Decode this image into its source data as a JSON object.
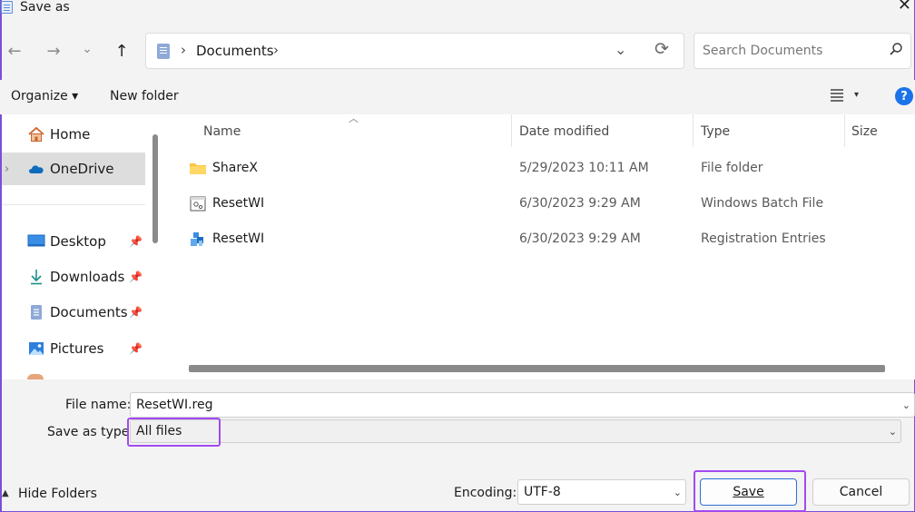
{
  "window": {
    "title": "Save as",
    "close_glyph": "✕"
  },
  "nav": {
    "back": "←",
    "forward": "→",
    "recent": "⌄",
    "up": "↑"
  },
  "address": {
    "separator": "›",
    "folder": "Documents",
    "dropdown": "⌄",
    "refresh": "⟳"
  },
  "search": {
    "placeholder": "Search Documents",
    "icon": "search-icon"
  },
  "toolbar": {
    "organize": "Organize ▾",
    "new_folder": "New folder",
    "help": "?"
  },
  "sidebar": {
    "items": [
      {
        "label": "Home",
        "icon": "home-icon"
      },
      {
        "label": "OneDrive",
        "icon": "cloud-icon",
        "selected": true
      },
      {
        "label": "Desktop",
        "icon": "desktop-icon",
        "pinned": true
      },
      {
        "label": "Downloads",
        "icon": "download-icon",
        "pinned": true
      },
      {
        "label": "Documents",
        "icon": "document-icon",
        "pinned": true
      },
      {
        "label": "Pictures",
        "icon": "picture-icon",
        "pinned": true
      }
    ]
  },
  "columns": [
    "Name",
    "Date modified",
    "Type",
    "Size"
  ],
  "files": [
    {
      "name": "ShareX",
      "date": "5/29/2023 10:11 AM",
      "type": "File folder",
      "icon": "folder-icon"
    },
    {
      "name": "ResetWI",
      "date": "6/30/2023 9:29 AM",
      "type": "Windows Batch File",
      "icon": "batch-file-icon"
    },
    {
      "name": "ResetWI",
      "date": "6/30/2023 9:29 AM",
      "type": "Registration Entries",
      "icon": "registry-file-icon"
    }
  ],
  "form": {
    "file_name_label": "File name:",
    "file_name_value": "ResetWI.reg",
    "save_type_label": "Save as type:",
    "save_type_value": "All files",
    "encoding_label": "Encoding:",
    "encoding_value": "UTF-8"
  },
  "footer": {
    "hide_folders": "Hide Folders",
    "save": "Save",
    "cancel": "Cancel"
  },
  "colors": {
    "highlight": "#a24af0",
    "accent": "#1a73e8"
  }
}
